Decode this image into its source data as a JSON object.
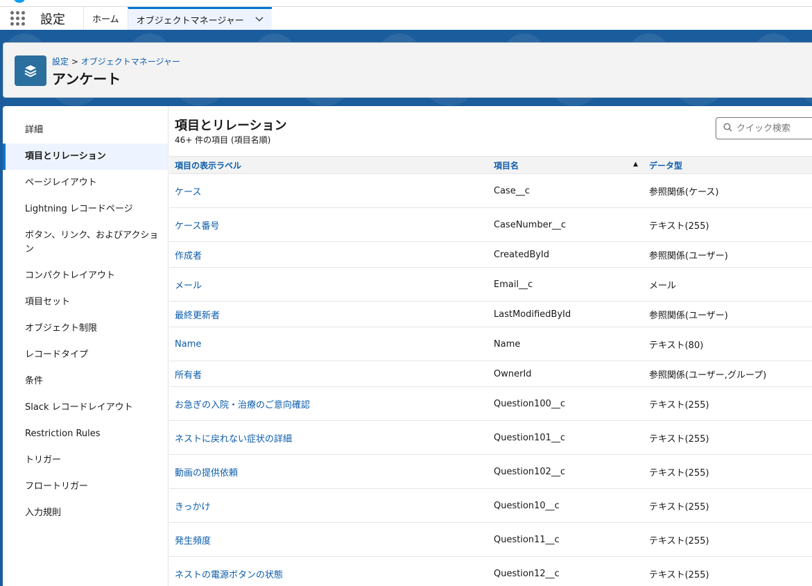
{
  "app": {
    "name": "設定"
  },
  "nav": {
    "tabs": [
      {
        "label": "ホーム"
      },
      {
        "label": "オブジェクトマネージャー"
      }
    ]
  },
  "header": {
    "breadcrumb": {
      "root": "設定",
      "sep": ">",
      "current": "オブジェクトマネージャー"
    },
    "title": "アンケート"
  },
  "sidebar": {
    "items": [
      {
        "label": "詳細"
      },
      {
        "label": "項目とリレーション"
      },
      {
        "label": "ページレイアウト"
      },
      {
        "label": "Lightning レコードページ"
      },
      {
        "label": "ボタン、リンク、およびアクション"
      },
      {
        "label": "コンパクトレイアウト"
      },
      {
        "label": "項目セット"
      },
      {
        "label": "オブジェクト制限"
      },
      {
        "label": "レコードタイプ"
      },
      {
        "label": "条件"
      },
      {
        "label": "Slack レコードレイアウト"
      },
      {
        "label": "Restriction Rules"
      },
      {
        "label": "トリガー"
      },
      {
        "label": "フロートリガー"
      },
      {
        "label": "入力規則"
      }
    ],
    "selected_index": 1
  },
  "content": {
    "title": "項目とリレーション",
    "subtitle": "46+ 件の項目 (項目名順)",
    "search_placeholder": "クイック検索",
    "columns": [
      "項目の表示ラベル",
      "項目名",
      "データ型"
    ],
    "rows": [
      {
        "label": "ケース",
        "name": "Case__c",
        "type": "参照関係(ケース)"
      },
      {
        "label": "ケース番号",
        "name": "CaseNumber__c",
        "type": "テキスト(255)"
      },
      {
        "label": "作成者",
        "name": "CreatedById",
        "type": "参照関係(ユーザー)"
      },
      {
        "label": "メール",
        "name": "Email__c",
        "type": "メール"
      },
      {
        "label": "最終更新者",
        "name": "LastModifiedById",
        "type": "参照関係(ユーザー)"
      },
      {
        "label": "Name",
        "name": "Name",
        "type": "テキスト(80)"
      },
      {
        "label": "所有者",
        "name": "OwnerId",
        "type": "参照関係(ユーザー,グループ)"
      },
      {
        "label": "お急ぎの入院・治療のご意向確認",
        "name": "Question100__c",
        "type": "テキスト(255)"
      },
      {
        "label": "ネストに戻れない症状の詳細",
        "name": "Question101__c",
        "type": "テキスト(255)"
      },
      {
        "label": "動画の提供依頼",
        "name": "Question102__c",
        "type": "テキスト(255)"
      },
      {
        "label": "きっかけ",
        "name": "Question10__c",
        "type": "テキスト(255)"
      },
      {
        "label": "発生頻度",
        "name": "Question11__c",
        "type": "テキスト(255)"
      },
      {
        "label": "ネストの電源ボタンの状態",
        "name": "Question12__c",
        "type": "テキスト(255)"
      }
    ]
  },
  "icons": {
    "app_launcher": "waffle-icon",
    "object": "layers-icon",
    "tab_menu": "chevron-down-icon",
    "search": "search-icon",
    "sort": "sort-ascending-icon"
  },
  "colors": {
    "brand": "#0176d3",
    "link": "#0b5cab",
    "header_band": "#1b5d9c",
    "object_icon": "#2a6f9e"
  }
}
